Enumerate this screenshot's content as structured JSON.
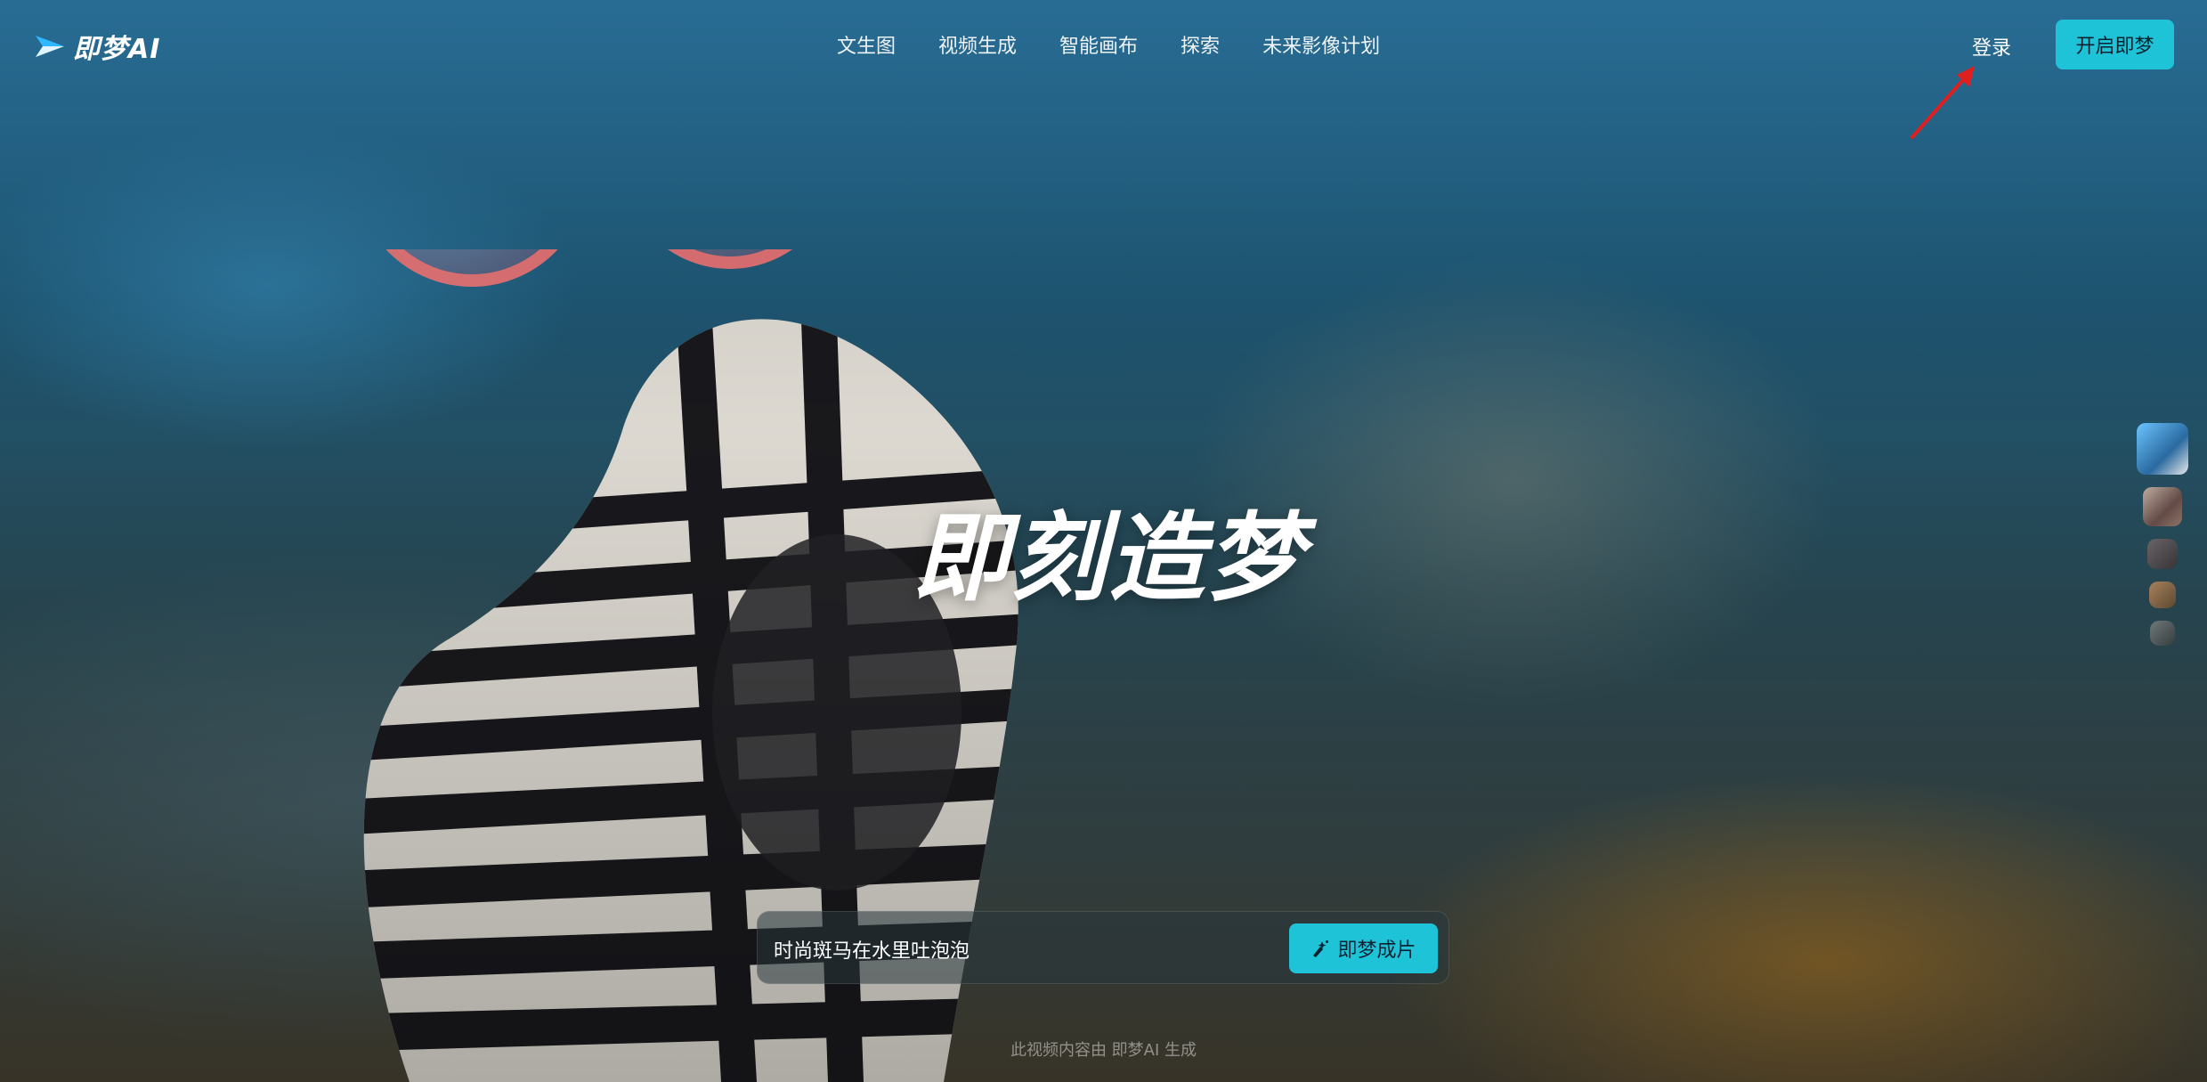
{
  "header": {
    "logo_text": "即梦AI",
    "nav": [
      {
        "label": "文生图"
      },
      {
        "label": "视频生成"
      },
      {
        "label": "智能画布"
      },
      {
        "label": "探索"
      },
      {
        "label": "未来影像计划"
      }
    ],
    "login_label": "登录",
    "open_button_label": "开启即梦"
  },
  "hero": {
    "title": "即刻造梦"
  },
  "prompt_bar": {
    "prompt_text": "时尚斑马在水里吐泡泡",
    "generate_button_label": "即梦成片"
  },
  "footer": {
    "note": "此视频内容由 即梦AI 生成"
  },
  "colors": {
    "accent": "#1ec3d8",
    "annotation_arrow": "#e02020"
  },
  "icons": {
    "logo": "jimeng-logo-icon",
    "generate": "sparkle-brush-icon"
  }
}
